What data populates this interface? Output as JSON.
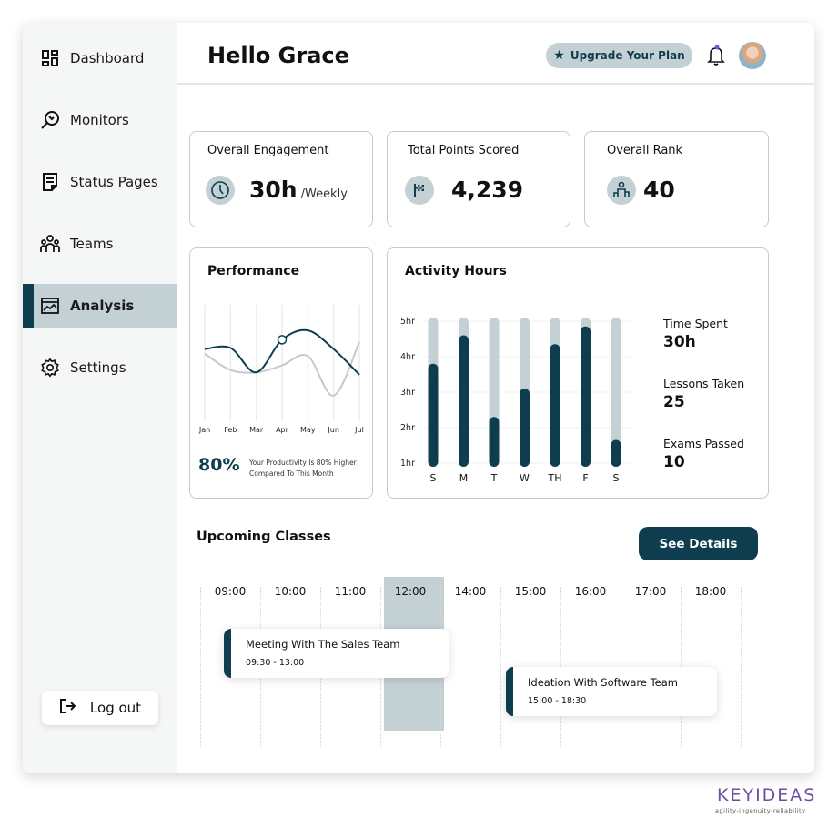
{
  "sidebar": {
    "items": [
      {
        "label": "Dashboard",
        "icon": "dashboard-icon",
        "active": false
      },
      {
        "label": "Monitors",
        "icon": "monitor-search-icon",
        "active": false
      },
      {
        "label": "Status Pages",
        "icon": "document-icon",
        "active": false
      },
      {
        "label": "Teams",
        "icon": "team-icon",
        "active": false
      },
      {
        "label": "Analysis",
        "icon": "analysis-chart-icon",
        "active": true
      },
      {
        "label": "Settings",
        "icon": "gear-icon",
        "active": false
      }
    ],
    "logout_label": "Log out"
  },
  "header": {
    "title": "Hello Grace",
    "upgrade_label": "Upgrade Your Plan",
    "notification_dot_color": "#7b4fd6"
  },
  "stats": [
    {
      "label": "Overall Engagement",
      "value": "30h",
      "unit": "/Weekly",
      "icon": "clock-icon"
    },
    {
      "label": "Total Points Scored",
      "value": "4,239",
      "unit": "",
      "icon": "checkered-flag-icon"
    },
    {
      "label": "Overall Rank",
      "value": "40",
      "unit": "",
      "icon": "podium-icon"
    }
  ],
  "performance": {
    "title": "Performance",
    "percent": "80%",
    "note": "Your Productivity Is 80% Higher Compared To This Month",
    "chart_data": {
      "type": "line",
      "categories": [
        "Jan",
        "Feb",
        "Mar",
        "Apr",
        "May",
        "Jun",
        "Jul"
      ],
      "series": [
        {
          "name": "current",
          "color": "#0f3d50",
          "values": [
            62,
            63,
            42,
            70,
            78,
            62,
            40
          ]
        },
        {
          "name": "previous",
          "color": "#c8c8c8",
          "values": [
            58,
            44,
            42,
            48,
            56,
            22,
            68
          ]
        }
      ],
      "highlight_index": 3,
      "ylim": [
        0,
        100
      ]
    }
  },
  "activity": {
    "title": "Activity Hours",
    "chart_data": {
      "type": "bar",
      "categories": [
        "S",
        "M",
        "T",
        "W",
        "TH",
        "F",
        "S"
      ],
      "values": [
        3.7,
        4.5,
        2.2,
        3.0,
        4.25,
        4.75,
        1.55
      ],
      "max_values": [
        5,
        5,
        5,
        5,
        5,
        5,
        5
      ],
      "yticks": [
        "1hr",
        "2hr",
        "3hr",
        "4hr",
        "5hr"
      ],
      "ylim": [
        1,
        5
      ],
      "colors": {
        "fill": "#0f3d50",
        "track": "#c3d0d4"
      }
    },
    "summary": [
      {
        "label": "Time Spent",
        "value": "30h"
      },
      {
        "label": "Lessons Taken",
        "value": "25"
      },
      {
        "label": "Exams Passed",
        "value": "10"
      }
    ]
  },
  "classes": {
    "title": "Upcoming Classes",
    "see_details_label": "See Details",
    "times": [
      "09:00",
      "10:00",
      "11:00",
      "12:00",
      "14:00",
      "15:00",
      "16:00",
      "17:00",
      "18:00"
    ],
    "highlighted_time": "12:00",
    "events": [
      {
        "title": "Meeting With The Sales Team",
        "time": "09:30 - 13:00"
      },
      {
        "title": "Ideation With Software Team",
        "time": "15:00 - 18:30"
      }
    ]
  },
  "branding": {
    "name": "KEYIDEAS",
    "tagline": "agility-ingenuity-reliability"
  },
  "colors": {
    "primary": "#0f3d50",
    "accent_light": "#c3d0d4",
    "sidebar_bg": "#f5f6f6"
  }
}
